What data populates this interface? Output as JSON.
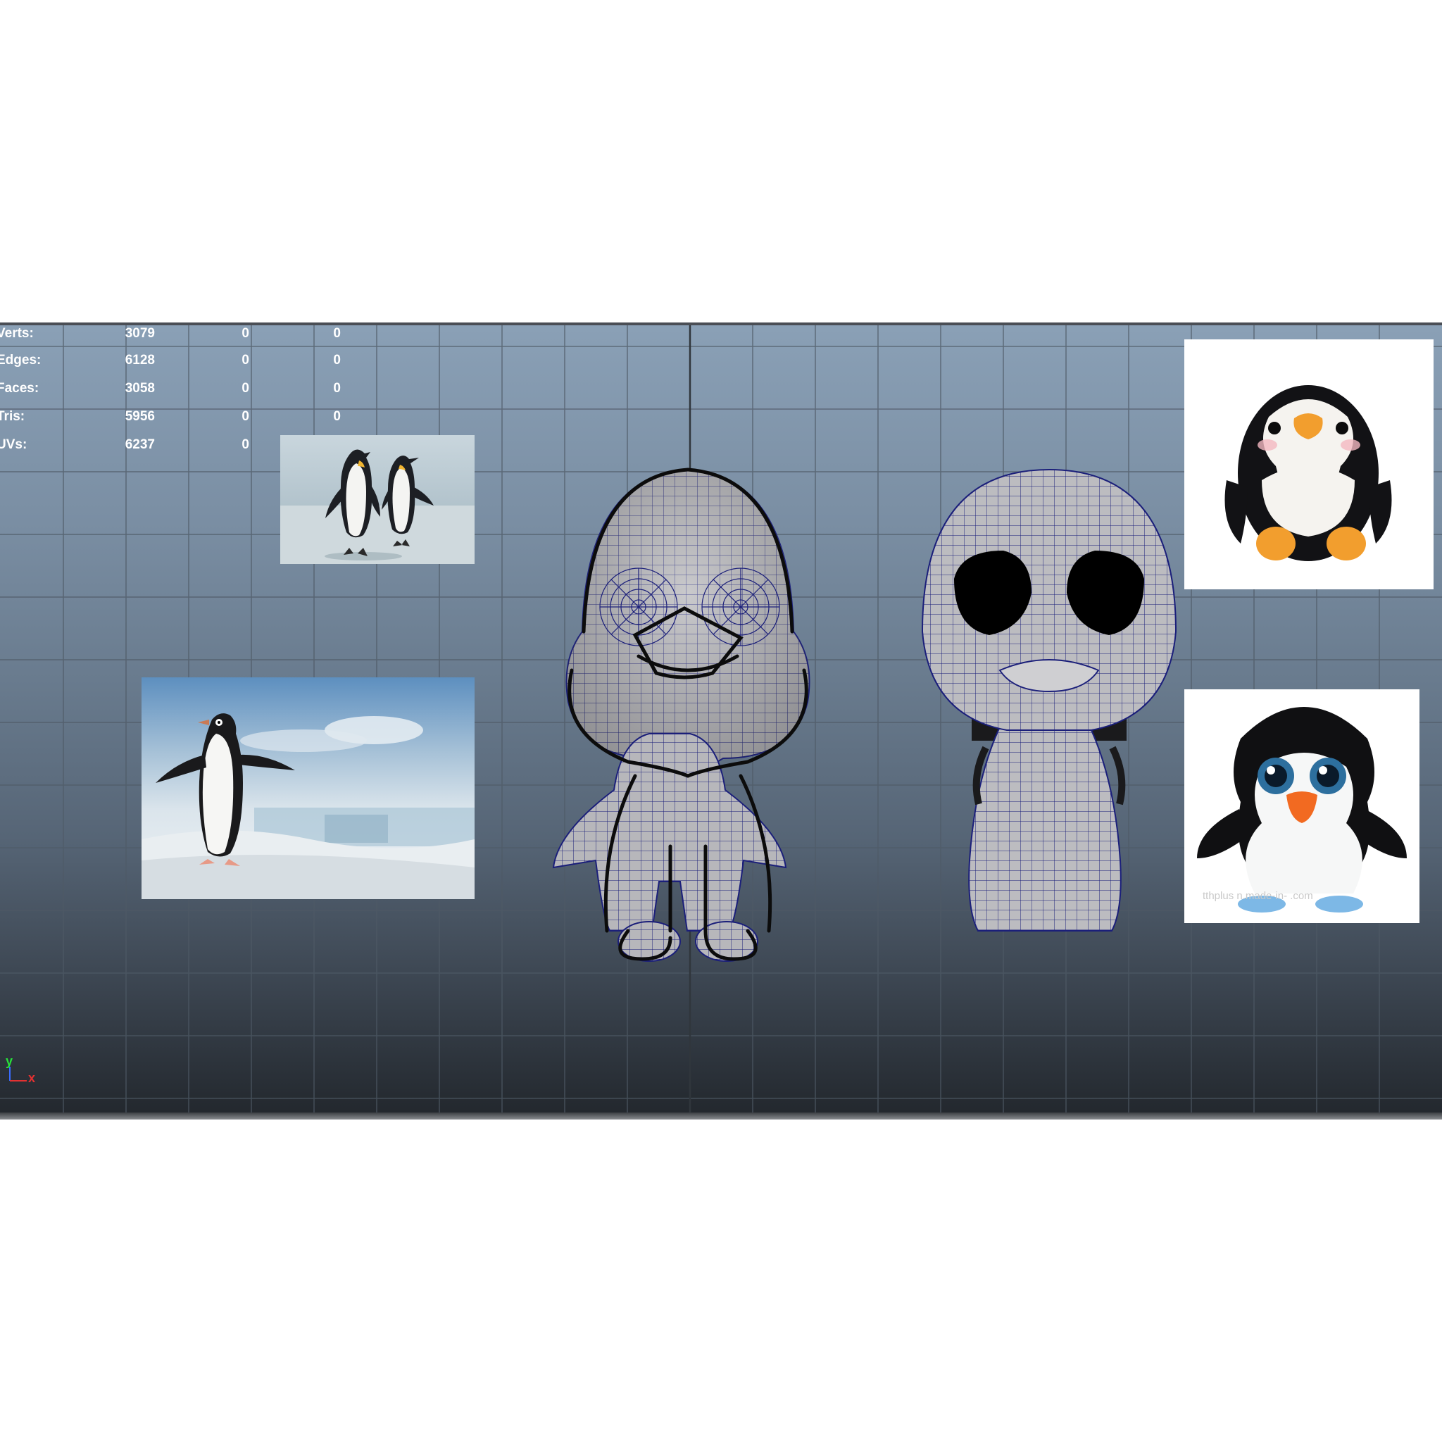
{
  "viewport": {
    "name": "front",
    "background_top": "#8aa0b6",
    "background_bottom": "#23282e"
  },
  "hud": {
    "rows": [
      {
        "label": "Verts:",
        "v1": "3079",
        "v2": "0",
        "v3": "0"
      },
      {
        "label": "Edges:",
        "v1": "6128",
        "v2": "0",
        "v3": "0"
      },
      {
        "label": "Faces:",
        "v1": "3058",
        "v2": "0",
        "v3": "0"
      },
      {
        "label": "Tris:",
        "v1": "5956",
        "v2": "0",
        "v3": "0"
      },
      {
        "label": "UVs:",
        "v1": "6237",
        "v2": "0",
        "v3": ""
      }
    ]
  },
  "axis": {
    "y": "y",
    "x": "x"
  },
  "reference_images": {
    "king_penguins": {
      "description_icon": "photo-two-king-penguins"
    },
    "adelie_penguin": {
      "description_icon": "photo-adelie-penguin"
    },
    "plush_toy_1": {
      "description_icon": "photo-plush-penguin"
    },
    "plush_toy_2": {
      "description_icon": "photo-plush-penguin-big-eyes",
      "watermark": "tthplus    n.made-in-    .com"
    }
  },
  "models": {
    "left": {
      "description_icon": "wireframe-penguin-with-sketch"
    },
    "right": {
      "description_icon": "wireframe-penguin-shaded"
    }
  },
  "colors": {
    "wireframe": "#1b1f7a",
    "mesh_fill": "#b9b9bd",
    "hud_text": "#ffffff",
    "axis_x": "#e33131",
    "axis_y": "#27e33a"
  }
}
